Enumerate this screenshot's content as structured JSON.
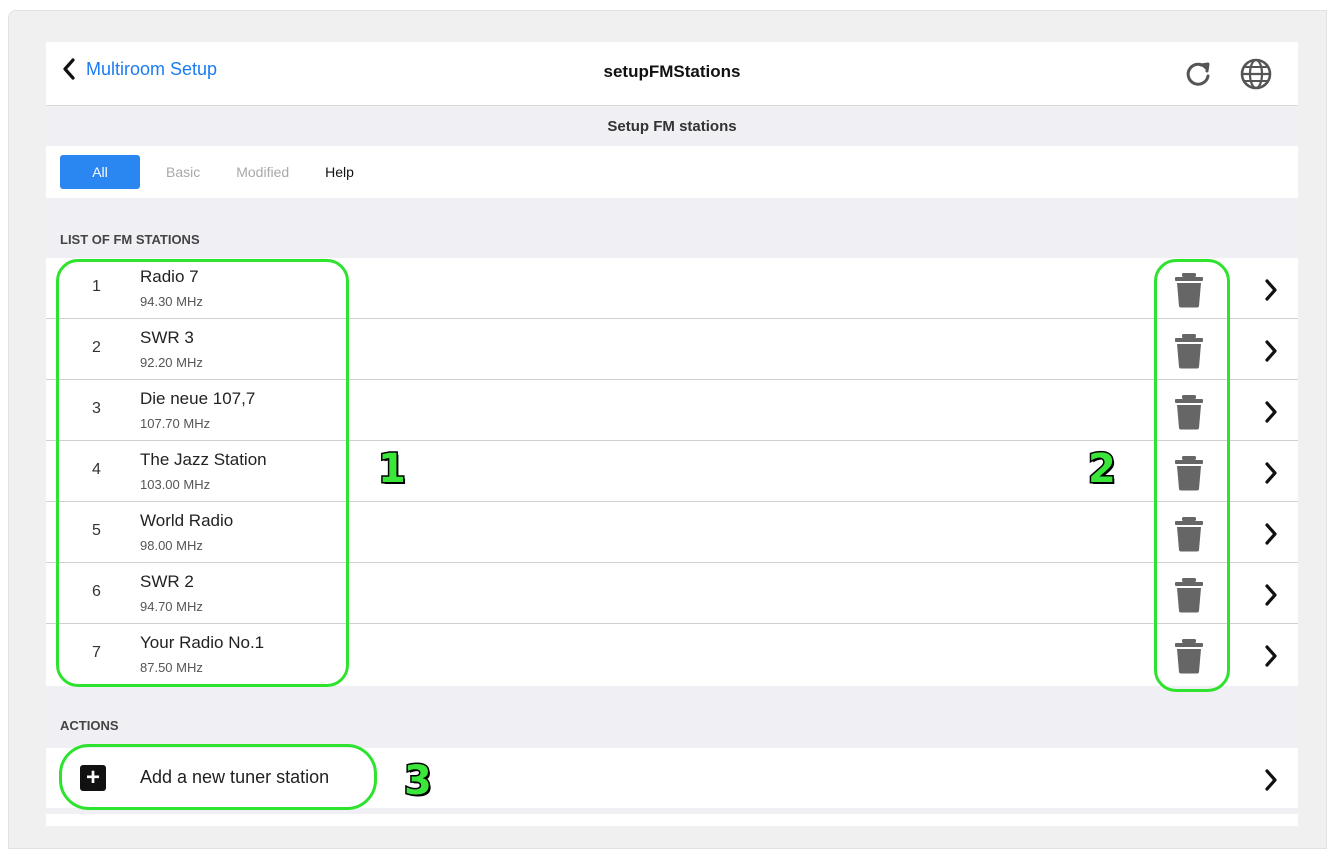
{
  "nav": {
    "back_label": "Multiroom Setup",
    "title": "setupFMStations",
    "icons": [
      "refresh-icon",
      "globe-icon"
    ]
  },
  "page_subtitle": "Setup FM stations",
  "tabs": [
    {
      "label": "All",
      "active": true
    },
    {
      "label": "Basic",
      "active": false
    },
    {
      "label": "Modified",
      "active": false
    },
    {
      "label": "Help",
      "active": false
    }
  ],
  "list_section_title": "LIST OF FM STATIONS",
  "stations": [
    {
      "index": "1",
      "name": "Radio 7",
      "freq": "94.30 MHz"
    },
    {
      "index": "2",
      "name": "SWR 3",
      "freq": "92.20 MHz"
    },
    {
      "index": "3",
      "name": "Die neue 107,7",
      "freq": "107.70 MHz"
    },
    {
      "index": "4",
      "name": "The Jazz Station",
      "freq": "103.00 MHz"
    },
    {
      "index": "5",
      "name": "World Radio",
      "freq": "98.00 MHz"
    },
    {
      "index": "6",
      "name": "SWR 2",
      "freq": "94.70 MHz"
    },
    {
      "index": "7",
      "name": "Your Radio No.1",
      "freq": "87.50 MHz"
    }
  ],
  "actions_section_title": "ACTIONS",
  "actions": {
    "add_label": "Add a new tuner station"
  },
  "annotations": [
    "1",
    "2",
    "3"
  ],
  "colors": {
    "accent": "#2a86f0",
    "link": "#1a7cf2",
    "annotation_green": "#2ee32e",
    "trash": "#666666"
  }
}
